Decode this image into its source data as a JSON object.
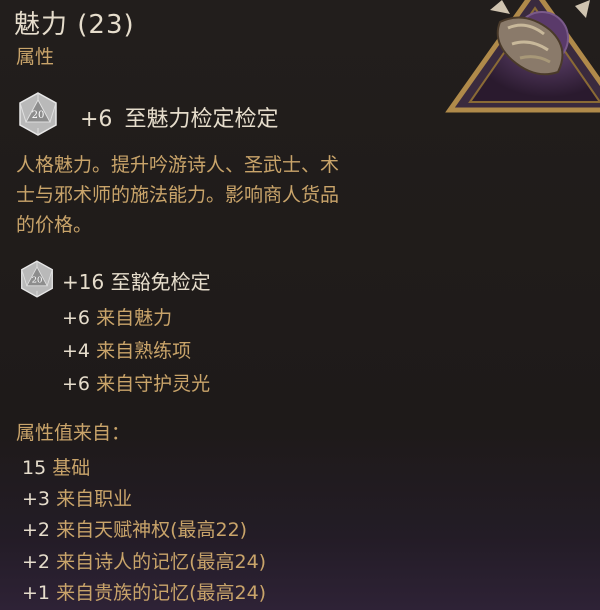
{
  "header": {
    "title": "魅力 (23)",
    "subtitle": "属性"
  },
  "check": {
    "dice_label": "20",
    "bonus": "+6",
    "label_part1": "至魅力检定",
    "label_part2": "检定"
  },
  "description": {
    "line1": "人格魅力。提升吟游诗人、圣武士、术",
    "line2": "士与邪术师的施法能力。影响商人货品",
    "line3": "的价格。"
  },
  "saving_throw": {
    "dice_label": "20",
    "text": "+16 至豁免检定",
    "sources": [
      {
        "value": "+6",
        "label": "来自魅力"
      },
      {
        "value": "+4",
        "label": "来自熟练项"
      },
      {
        "value": "+6",
        "label": "来自守护灵光"
      }
    ]
  },
  "attribute_sources": {
    "header": "属性值来自：",
    "rows": [
      {
        "value": "15",
        "label": "基础"
      },
      {
        "value": "+3",
        "label": "来自职业"
      },
      {
        "value": "+2",
        "label": "来自天赋神权(最高22)"
      },
      {
        "value": "+2",
        "label": "来自诗人的记忆(最高24)"
      },
      {
        "value": "+1",
        "label": "来自贵族的记忆(最高24)"
      }
    ]
  },
  "colors": {
    "text_light": "#e6ddcc",
    "text_gold": "#c9a46a",
    "background": "#1f1b1a"
  },
  "icons": {
    "emblem": "charisma-emblem-icon",
    "die": "d20-icon"
  }
}
